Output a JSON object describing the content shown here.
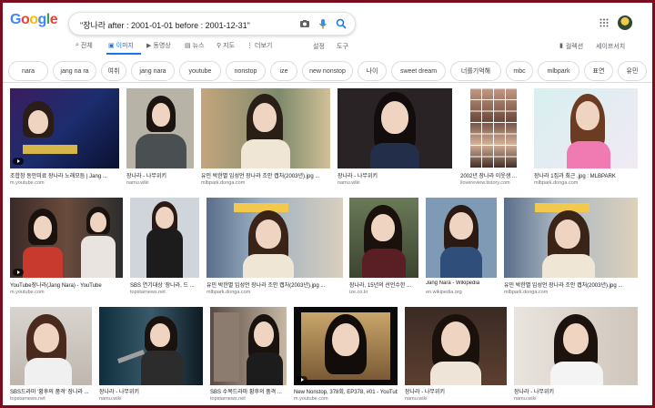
{
  "search": {
    "query": "\"장나라 after : 2001-01-01 before : 2001-12-31\""
  },
  "tabs": [
    {
      "label": "전체",
      "icon": "search-icon"
    },
    {
      "label": "이미지",
      "icon": "image-icon"
    },
    {
      "label": "동영상",
      "icon": "video-icon"
    },
    {
      "label": "뉴스",
      "icon": "news-icon"
    },
    {
      "label": "지도",
      "icon": "map-pin-icon"
    },
    {
      "label": "더보기",
      "icon": "more-icon"
    }
  ],
  "tools": {
    "settings": "설정",
    "tools": "도구"
  },
  "right_links": {
    "collections": "컬렉션",
    "safesearch": "세이프서치"
  },
  "chips": [
    "nara",
    "jang na ra",
    "여취",
    "jang nara",
    "youtube",
    "nonstop",
    "ize",
    "new nonstop",
    "나이",
    "sweet dream",
    "너를기억해",
    "mbc",
    "mlbpark",
    "표연",
    "유민"
  ],
  "images": [
    {
      "caption": "조합창 동안미료 장나라 노래모듬 | Jang ...",
      "source": "m.youtube.com"
    },
    {
      "caption": "장나라 - 나무위키",
      "source": "namu.wiki"
    },
    {
      "caption": "유민 박한별 임성언 장나라 조안 캡처(2003년).jpg ...",
      "source": "mlbpark.donga.com"
    },
    {
      "caption": "장나라 - 나무위키",
      "source": "namu.wiki"
    },
    {
      "caption": "2002년 장나라 이웃생 ...",
      "source": "ilovereview.tistory.com"
    },
    {
      "caption": "장나라 1집과 최근 .jpg : MLBPARK",
      "source": "mlbpark.donga.com"
    },
    {
      "caption": "YouTube장나라(Jang Nara) - YouTube",
      "source": "m.youtube.com"
    },
    {
      "caption": "SBS 연기대상 '장나라, 드 ...",
      "source": "topstarnews.net"
    },
    {
      "caption": "유민 박한별 임성언 장나라 조안 캡처(2003년).jpg ...",
      "source": "mlbpark.donga.com"
    },
    {
      "caption": "장나라, 15년의 선언수한 ...",
      "source": "ize.co.kr"
    },
    {
      "caption": "Jang Nara - Wikipedia",
      "source": "en.wikipedia.org"
    },
    {
      "caption": "유민 박한별 임성언 장나라 조안 캡처(2003년).jpg ...",
      "source": "mlbpark.donga.com"
    },
    {
      "caption": "SBS드라마 '황후의 품격' 장나라 ...",
      "source": "topstarnews.net"
    },
    {
      "caption": "장나라 - 나무위키",
      "source": "namu.wiki"
    },
    {
      "caption": "SBS 수목드라마 황후의 품격 ...",
      "source": "topstarnews.net"
    },
    {
      "caption": "New Nonstop, 378회, EP378, #01 - YouTube",
      "source": "m.youtube.com"
    },
    {
      "caption": "장나라 - 나무위키",
      "source": "namu.wiki"
    },
    {
      "caption": "장나라 - 나무위키",
      "source": "namu.wiki"
    }
  ],
  "colors": {
    "accent": "#1a73e8",
    "frame": "#7a0e1e"
  }
}
